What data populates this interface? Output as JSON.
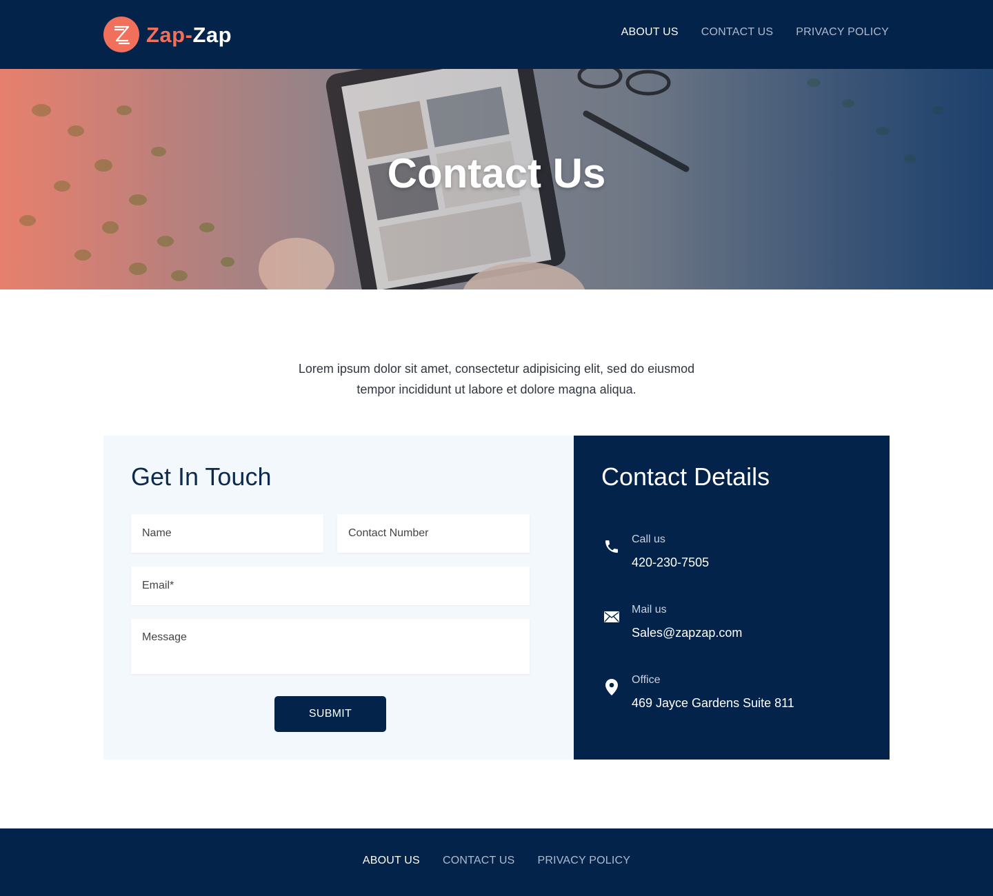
{
  "brand": {
    "name_part1": "Zap-",
    "name_part2": "Zap",
    "colors": {
      "primary": "#03234a",
      "accent": "#f0705c",
      "panel_bg": "#f3f8fc"
    }
  },
  "header": {
    "nav": [
      {
        "label": "ABOUT US",
        "active": true
      },
      {
        "label": "CONTACT US",
        "active": false
      },
      {
        "label": "PRIVACY POLICY",
        "active": false
      }
    ]
  },
  "hero": {
    "title": "Contact Us"
  },
  "intro": {
    "line1": "Lorem ipsum dolor sit amet, consectetur adipisicing elit, sed do eiusmod",
    "line2": "tempor incididunt ut labore et dolore magna aliqua."
  },
  "form": {
    "title": "Get In Touch",
    "name_placeholder": "Name",
    "contact_placeholder": "Contact Number",
    "email_placeholder": "Email*",
    "message_placeholder": "Message",
    "submit_label": "SUBMIT"
  },
  "details": {
    "title": "Contact Details",
    "items": [
      {
        "icon": "phone-icon",
        "label": "Call us",
        "value": "420-230-7505"
      },
      {
        "icon": "mail-icon",
        "label": "Mail us",
        "value": "Sales@zapzap.com"
      },
      {
        "icon": "location-pin-icon",
        "label": "Office",
        "value": "469 Jayce Gardens Suite 811"
      }
    ]
  },
  "footer": {
    "nav": [
      {
        "label": "ABOUT US",
        "active": true
      },
      {
        "label": "CONTACT US",
        "active": false
      },
      {
        "label": "PRIVACY POLICY",
        "active": false
      }
    ]
  }
}
